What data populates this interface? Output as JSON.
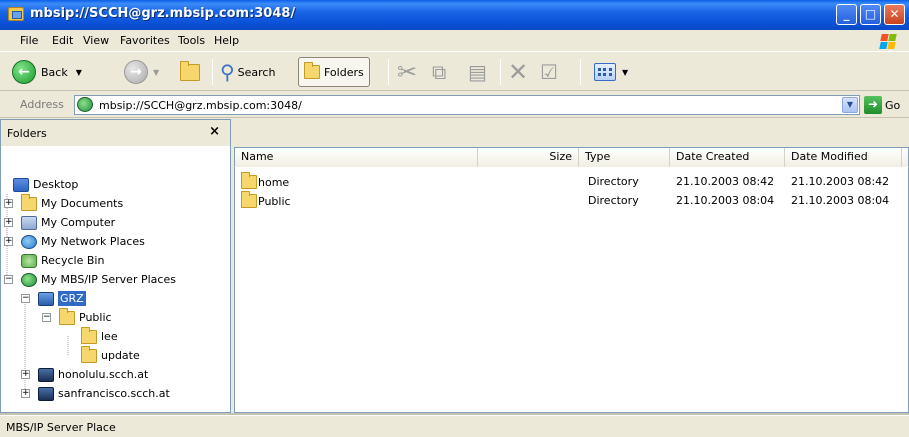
{
  "window": {
    "title": "mbsip://SCCH@grz.mbsip.com:3048/",
    "controls": [
      "minimize",
      "maximize",
      "close"
    ]
  },
  "menu": {
    "items": [
      {
        "label": "File"
      },
      {
        "label": "Edit"
      },
      {
        "label": "View"
      },
      {
        "label": "Favorites"
      },
      {
        "label": "Tools"
      },
      {
        "label": "Help"
      }
    ]
  },
  "toolbar": {
    "back_label": "Back",
    "search_label": "Search",
    "folders_label": "Folders"
  },
  "address": {
    "label": "Address",
    "value": "mbsip://SCCH@grz.mbsip.com:3048/",
    "go_label": "Go"
  },
  "folders_pane": {
    "title": "Folders",
    "close_glyph": "×",
    "tree": [
      {
        "label": "Desktop",
        "icon": "desktop-icon",
        "expander": ""
      },
      {
        "label": "My Documents",
        "icon": "folder-icon",
        "expander": "+"
      },
      {
        "label": "My Computer",
        "icon": "computer-icon",
        "expander": "+"
      },
      {
        "label": "My Network Places",
        "icon": "network-icon",
        "expander": "+"
      },
      {
        "label": "Recycle Bin",
        "icon": "recycle-bin-icon",
        "expander": ""
      },
      {
        "label": "My MBS/IP Server Places",
        "icon": "mbs-server-places-icon",
        "expander": "−"
      },
      {
        "label": "GRZ",
        "icon": "server-icon",
        "expander": "−",
        "selected": true
      },
      {
        "label": "Public",
        "icon": "folder-icon",
        "expander": "−"
      },
      {
        "label": "lee",
        "icon": "folder-icon",
        "expander": ""
      },
      {
        "label": "update",
        "icon": "folder-icon",
        "expander": ""
      },
      {
        "label": "honolulu.scch.at",
        "icon": "server-icon",
        "expander": "+"
      },
      {
        "label": "sanfrancisco.scch.at",
        "icon": "server-icon",
        "expander": "+"
      }
    ]
  },
  "file_list": {
    "columns": [
      "Name",
      "Size",
      "Type",
      "Date Created",
      "Date Modified"
    ],
    "rows": [
      {
        "name": "home",
        "size": "",
        "type": "Directory",
        "created": "21.10.2003 08:42",
        "modified": "21.10.2003 08:42"
      },
      {
        "name": "Public",
        "size": "",
        "type": "Directory",
        "created": "21.10.2003 08:04",
        "modified": "21.10.2003 08:04"
      }
    ]
  },
  "status": {
    "text": "MBS/IP Server Place"
  },
  "colors": {
    "titlebar": "#0A5FE8",
    "selection": "#316AC5",
    "chrome": "#ECE9D8"
  }
}
